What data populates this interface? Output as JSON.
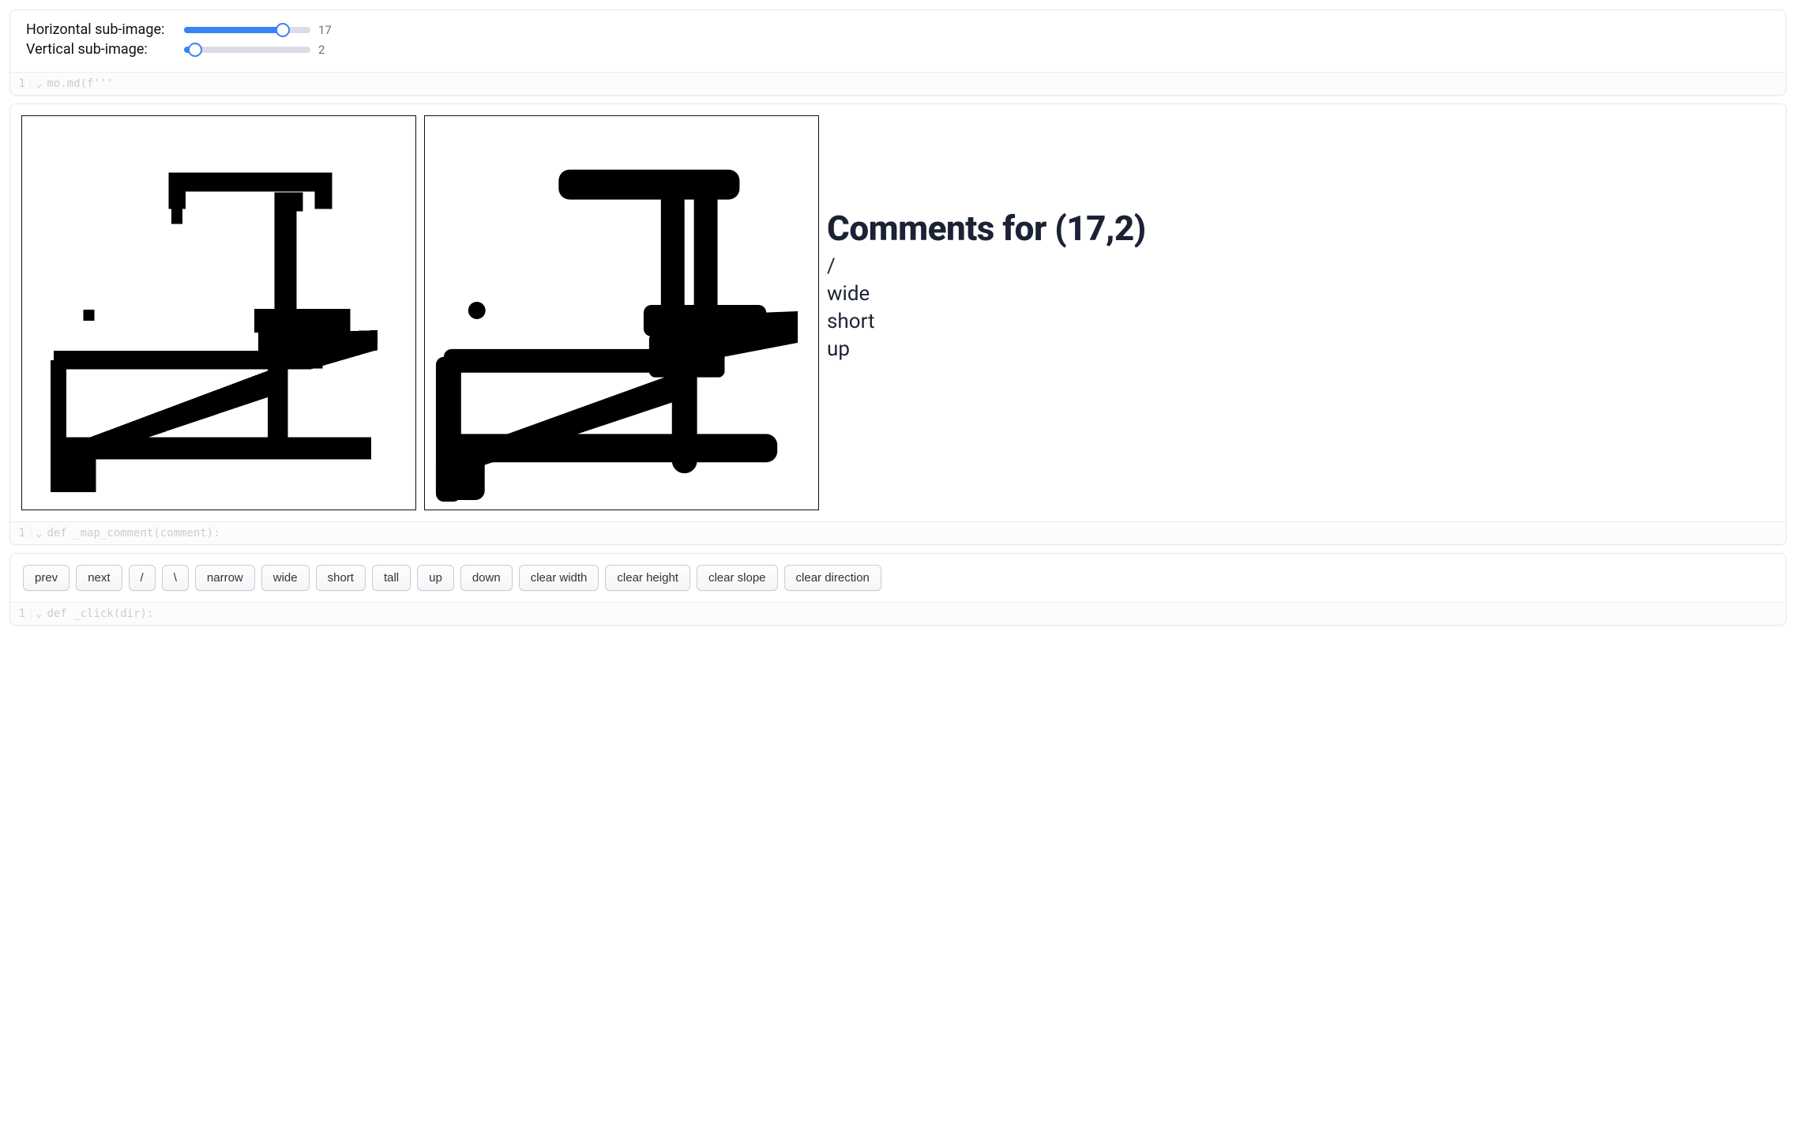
{
  "sliders": {
    "horizontal": {
      "label": "Horizontal sub-image:",
      "value": 17,
      "min": 0,
      "max": 22,
      "fill_pct": 78
    },
    "vertical": {
      "label": "Vertical sub-image:",
      "value": 2,
      "min": 0,
      "max": 22,
      "fill_pct": 9
    }
  },
  "code_strips": {
    "cell1": {
      "lineno": "1",
      "text": "mo.md(f'''"
    },
    "cell2": {
      "lineno": "1",
      "text": "def _map_comment(comment):"
    },
    "cell3": {
      "lineno": "1",
      "text": "def _click(dir):"
    }
  },
  "comments": {
    "title": "Comments for (17,2)",
    "lines": [
      "/",
      "wide",
      "short",
      "up"
    ]
  },
  "buttons": [
    "prev",
    "next",
    "/",
    "\\",
    "narrow",
    "wide",
    "short",
    "tall",
    "up",
    "down",
    "clear width",
    "clear height",
    "clear slope",
    "clear direction"
  ]
}
